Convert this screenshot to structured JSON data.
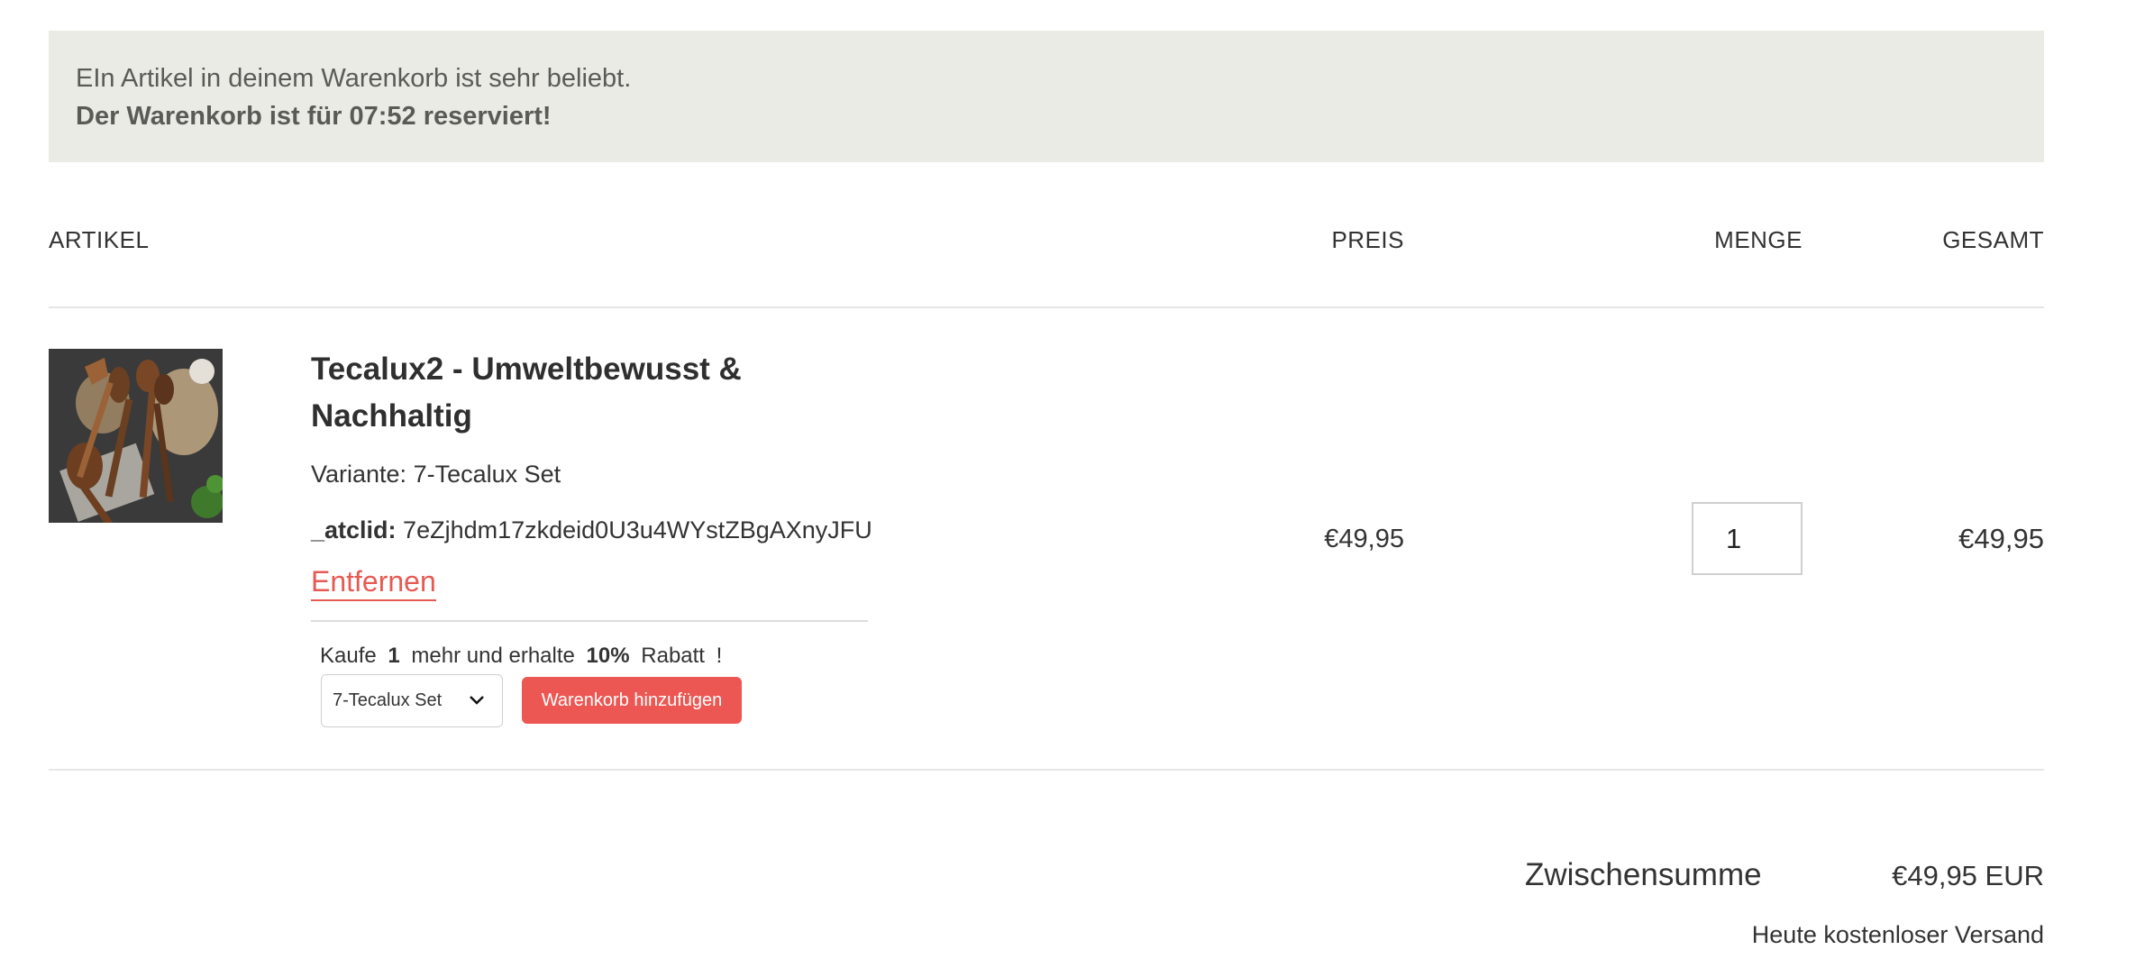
{
  "notice": {
    "line1": "EIn Artikel in deinem Warenkorb ist sehr beliebt.",
    "line2": "Der Warenkorb ist für 07:52 reserviert!"
  },
  "table_headers": {
    "artikel": "ARTIKEL",
    "preis": "PREIS",
    "menge": "MENGE",
    "gesamt": "GESAMT"
  },
  "item": {
    "title": "Tecalux2 - Umweltbewusst & Nachhaltig",
    "variant": "Variante: 7-Tecalux Set",
    "atclid_label": "_atclid:",
    "atclid_value": "7eZjhdm17zkdeid0U3u4WYstZBgAXnyJFU",
    "remove_label": "Entfernen",
    "price": "€49,95",
    "quantity": "1",
    "total": "€49,95",
    "image_icon": "wooden-utensils-photo"
  },
  "upsell": {
    "pre": "Kaufe",
    "count": "1",
    "mid": "mehr und erhalte",
    "percent": "10%",
    "post": "Rabatt",
    "bang": "!",
    "selected_option": "7-Tecalux Set",
    "button_label": "Warenkorb hinzufügen"
  },
  "summary": {
    "subtotal_label": "Zwischensumme",
    "subtotal_value": "€49,95 EUR",
    "shipping_note": "Heute kostenloser Versand"
  },
  "colors": {
    "banner_bg": "#ebebe6",
    "accent": "#ec5753",
    "text": "#2f2f2f"
  }
}
